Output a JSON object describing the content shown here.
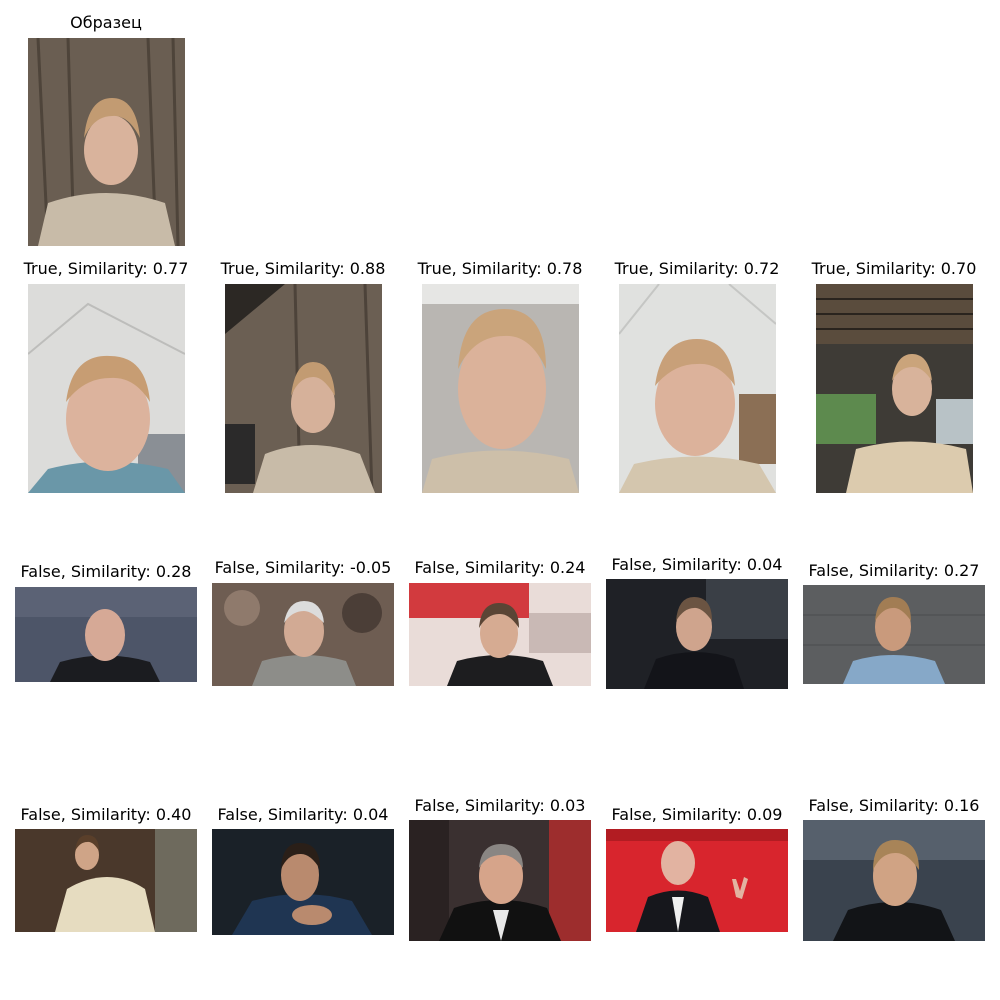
{
  "reference": {
    "caption": "Образец"
  },
  "rows": [
    {
      "items": [
        {
          "caption": "True, Similarity: 0.77"
        },
        {
          "caption": "True, Similarity: 0.88"
        },
        {
          "caption": "True, Similarity: 0.78"
        },
        {
          "caption": "True, Similarity: 0.72"
        },
        {
          "caption": "True, Similarity: 0.70"
        }
      ]
    },
    {
      "items": [
        {
          "caption": "False, Similarity: 0.28"
        },
        {
          "caption": "False, Similarity: -0.05"
        },
        {
          "caption": "False, Similarity: 0.24"
        },
        {
          "caption": "False, Similarity: 0.04"
        },
        {
          "caption": "False, Similarity: 0.27"
        }
      ]
    },
    {
      "items": [
        {
          "caption": "False, Similarity: 0.40"
        },
        {
          "caption": "False, Similarity: 0.04"
        },
        {
          "caption": "False, Similarity: 0.03"
        },
        {
          "caption": "False, Similarity: 0.09"
        },
        {
          "caption": "False, Similarity: 0.16"
        }
      ]
    }
  ]
}
